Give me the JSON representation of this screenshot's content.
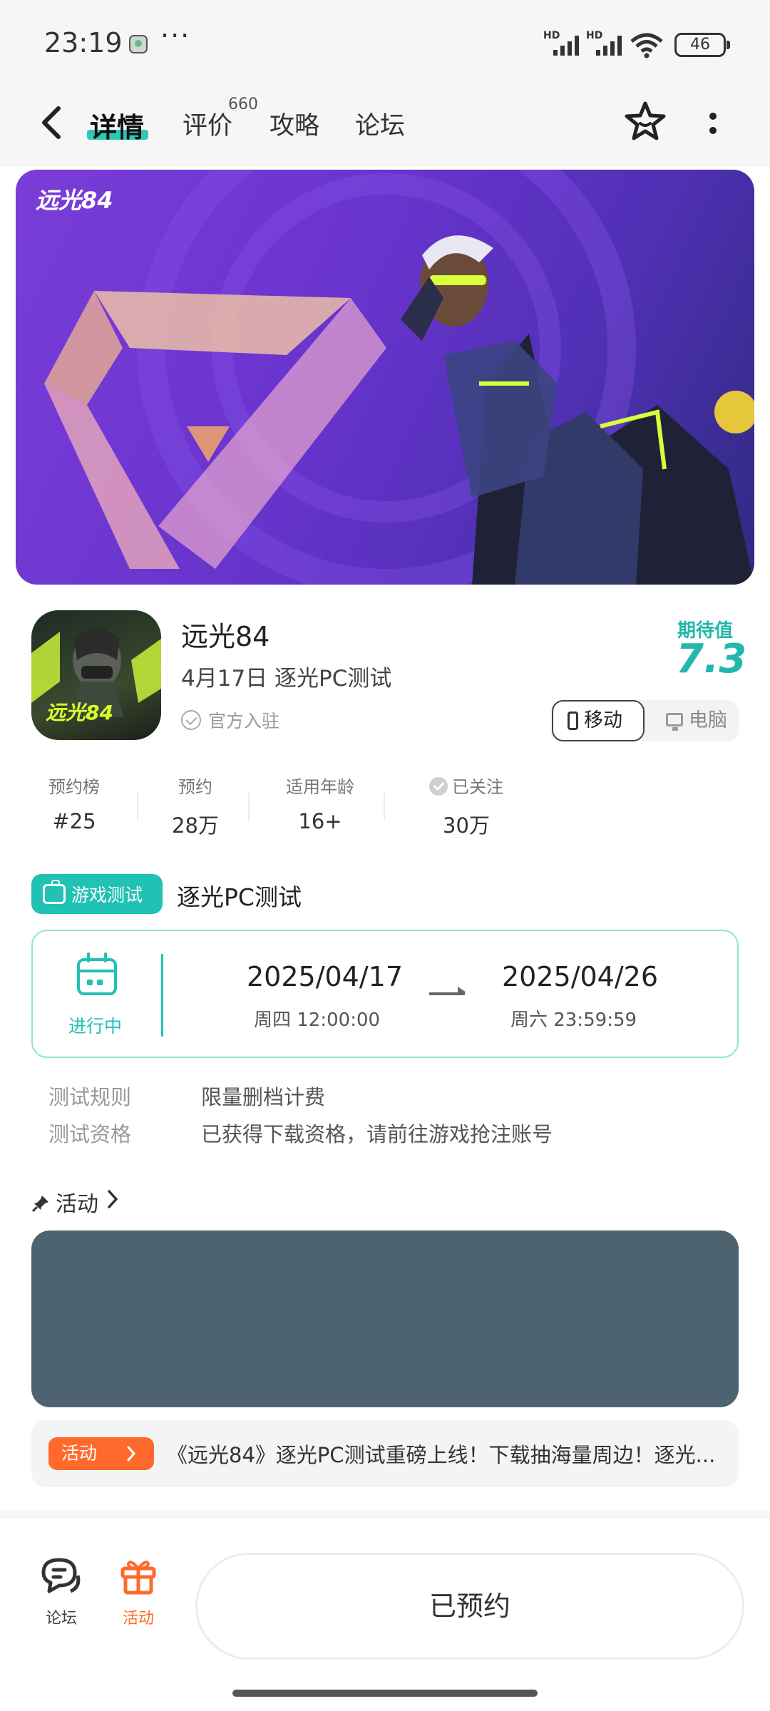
{
  "status_bar": {
    "time": "23:19",
    "battery": "46",
    "network_label": "HD"
  },
  "nav": {
    "tabs": [
      {
        "label": "详情",
        "active": true
      },
      {
        "label": "评价",
        "badge": "660"
      },
      {
        "label": "攻略"
      },
      {
        "label": "论坛"
      }
    ]
  },
  "banner": {
    "logo_text": "远光84"
  },
  "app": {
    "icon_text": "远光84",
    "name": "远光84",
    "subtitle": "4月17日 逐光PC测试",
    "official_label": "官方入驻",
    "expect_label": "期待值",
    "expect_value": "7.3",
    "platforms": {
      "mobile": "移动",
      "pc": "电脑",
      "selected": "移动"
    }
  },
  "stats": [
    {
      "label": "预约榜",
      "value": "#25"
    },
    {
      "label": "预约",
      "value": "28万"
    },
    {
      "label": "适用年龄",
      "value": "16+"
    },
    {
      "label": "已关注",
      "value": "30万"
    }
  ],
  "test": {
    "chip_label": "游戏测试",
    "title": "逐光PC测试",
    "status": "进行中",
    "start_date": "2025/04/17",
    "start_time": "周四  12:00:00",
    "end_date": "2025/04/26",
    "end_time": "周六  23:59:59",
    "rules": [
      {
        "key": "测试规则",
        "value": "限量删档计费"
      },
      {
        "key": "测试资格",
        "value": "已获得下载资格，请前往游戏抢注账号"
      }
    ]
  },
  "activity": {
    "heading": "活动",
    "news_tag": "活动",
    "news_text": "《远光84》逐光PC测试重磅上线！下载抽海量周边！逐光..."
  },
  "bottom": {
    "forum_label": "论坛",
    "activity_label": "活动",
    "reserve_label": "已预约"
  },
  "colors": {
    "accent": "#20c2b4",
    "orange": "#ff6a2c",
    "banner_purple": "#6a34cf"
  }
}
